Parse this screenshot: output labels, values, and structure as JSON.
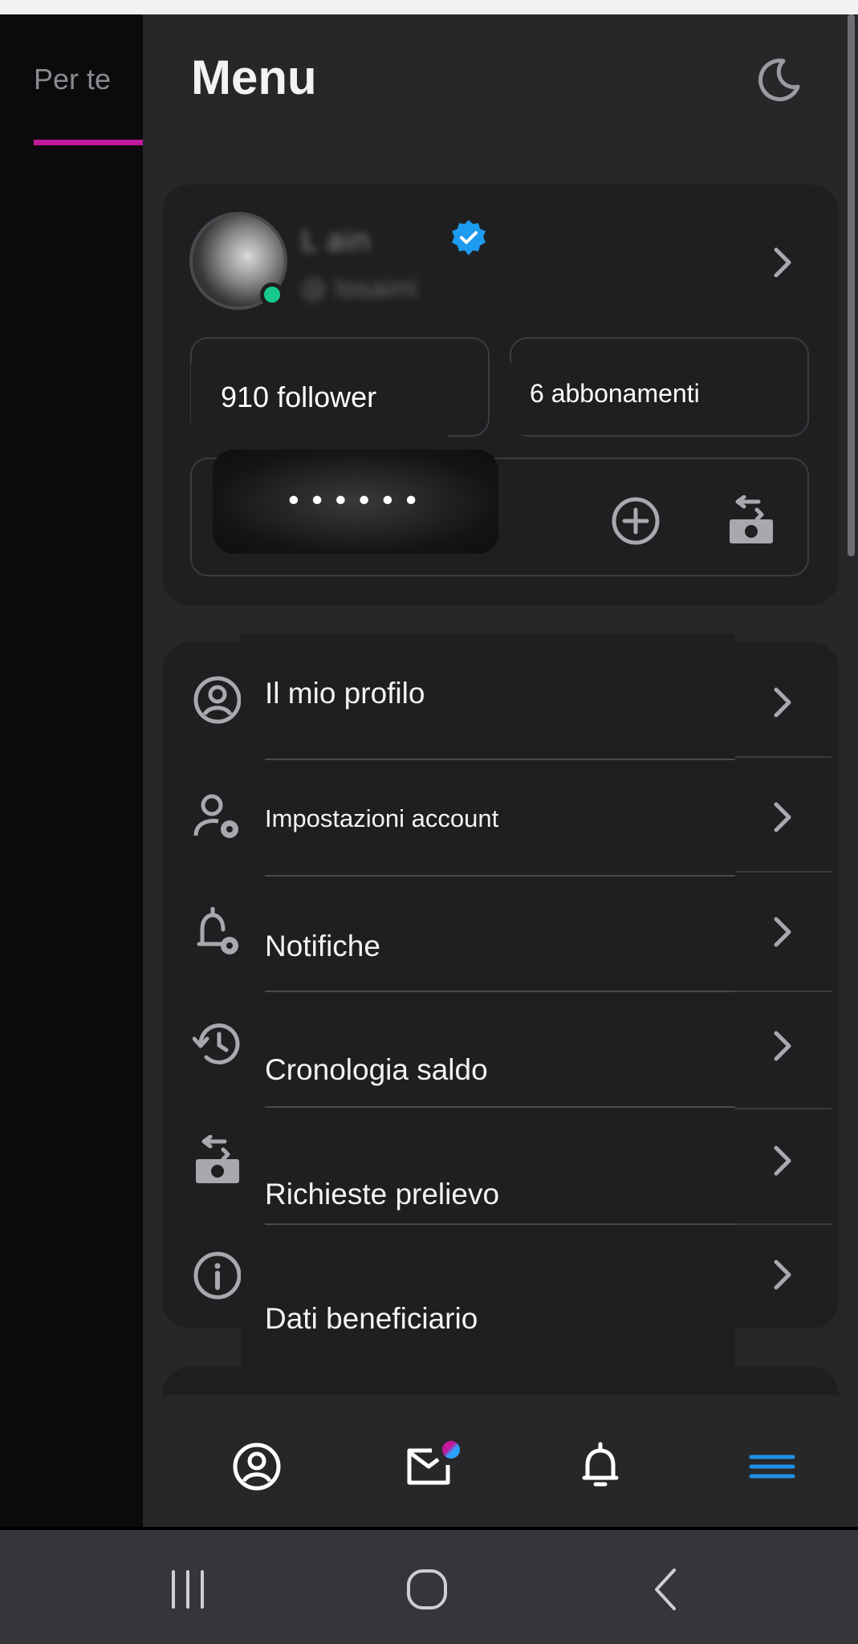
{
  "left_panel": {
    "tab_label": "Per te"
  },
  "header": {
    "title": "Menu",
    "theme_icon": "moon-icon"
  },
  "profile": {
    "name": "L     ain",
    "handle": "@ losaini",
    "verified_icon": "verified-badge-icon",
    "online_color": "#17c98a",
    "followers_label": "910 follower",
    "subscriptions_label": "6 abbonamenti",
    "balance_masked": "••••••",
    "add_funds_icon": "plus-circle-icon",
    "withdraw_icon": "cash-withdraw-icon"
  },
  "menu_items": [
    {
      "label": "Il mio profilo",
      "icon": "user-circle-icon"
    },
    {
      "label": "Impostazioni account",
      "icon": "user-settings-icon"
    },
    {
      "label": "Notifiche",
      "icon": "bell-settings-icon"
    },
    {
      "label": "Cronologia saldo",
      "icon": "history-icon"
    },
    {
      "label": "Richieste prelievo",
      "icon": "cash-withdraw-icon"
    },
    {
      "label": "Dati beneficiario",
      "icon": "info-icon"
    }
  ],
  "bottom_nav": [
    {
      "icon": "profile-icon"
    },
    {
      "icon": "messages-icon",
      "badge": true
    },
    {
      "icon": "notifications-icon"
    },
    {
      "icon": "hamburger-menu-icon",
      "active": true
    }
  ],
  "colors": {
    "accent": "#c2189a",
    "active_nav": "#1e90e8",
    "verified": "#1d9bf0",
    "drawer_bg": "#27272a",
    "card_bg": "#1f1f22"
  }
}
